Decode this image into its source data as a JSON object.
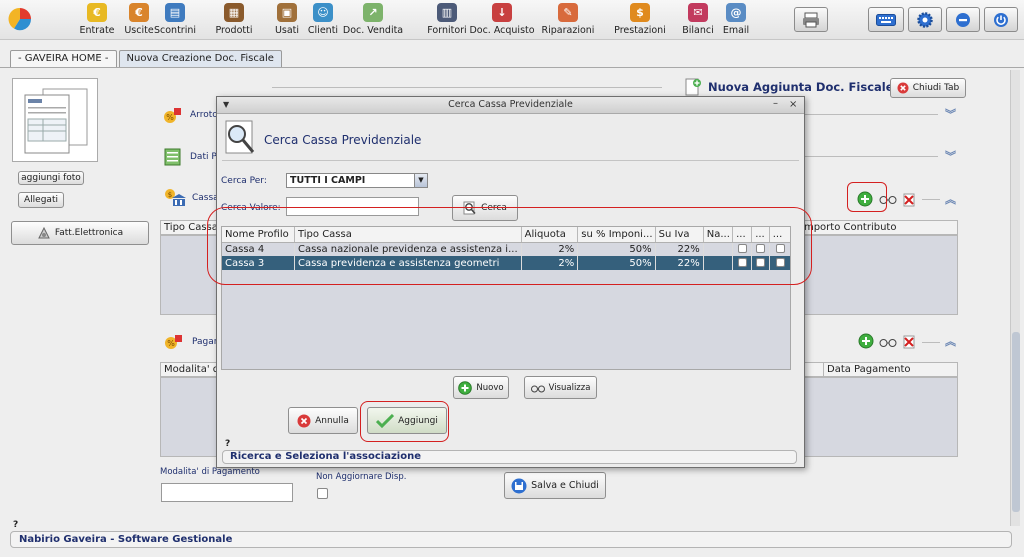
{
  "toolbar": {
    "items": [
      {
        "label": "Entrate",
        "icon": "coin-icon",
        "color": "#e8b923",
        "glyph": "€"
      },
      {
        "label": "Uscite",
        "icon": "coin-out-icon",
        "color": "#d9842b",
        "glyph": "€"
      },
      {
        "label": "Scontrini",
        "icon": "receipt-icon",
        "color": "#3f7bbf",
        "glyph": "▤"
      },
      {
        "label": "Prodotti",
        "icon": "boxes-icon",
        "color": "#8a5a2c",
        "glyph": "▦"
      },
      {
        "label": "Usati",
        "icon": "box-icon",
        "color": "#a0703a",
        "glyph": "▣"
      },
      {
        "label": "Clienti",
        "icon": "client-icon",
        "color": "#3c90c8",
        "glyph": "☺"
      },
      {
        "label": "Doc. Vendita",
        "icon": "sale-doc-icon",
        "color": "#7db36b",
        "glyph": "↗"
      },
      {
        "label": "Fornitori",
        "icon": "supplier-icon",
        "color": "#4c5a78",
        "glyph": "▥"
      },
      {
        "label": "Doc. Acquisto",
        "icon": "purchase-doc-icon",
        "color": "#c84040",
        "glyph": "↓"
      },
      {
        "label": "Riparazioni",
        "icon": "repair-icon",
        "color": "#d86a3c",
        "glyph": "✎"
      },
      {
        "label": "Prestazioni",
        "icon": "service-icon",
        "color": "#e08a1e",
        "glyph": "$"
      },
      {
        "label": "Bilanci",
        "icon": "balance-icon",
        "color": "#c23a5e",
        "glyph": "✉"
      },
      {
        "label": "Email",
        "icon": "email-icon",
        "color": "#5a8cc4",
        "glyph": "@"
      }
    ]
  },
  "tabs": [
    {
      "label": "- GAVEIRA HOME -"
    },
    {
      "label": "Nuova Creazione Doc. Fiscale"
    }
  ],
  "left": {
    "add_photo": "aggiungi foto",
    "attachments": "Allegati",
    "e_invoice": "Fatt.Elettronica"
  },
  "form": {
    "page_title": "Nuova Aggiunta Doc. Fiscale",
    "close_tab": "Chiudi Tab",
    "sections": {
      "rounding": "Arrotondamenti",
      "data": "Dati P",
      "cassa": "Cassa",
      "payments": "Pagamenti"
    },
    "cassa_grid": {
      "col_first": "Tipo Cassa",
      "col_last": "Importo Contributo"
    },
    "pay_grid": {
      "col_first": "Modalita' di",
      "col_last": "Data Pagamento"
    },
    "payment_mode_label": "Modalita' di Pagamento",
    "payment_mode_value": "",
    "no_update_label": "Non Aggiornare Disp.",
    "save_close": "Salva e Chiudi"
  },
  "dialog": {
    "window_title": "Cerca Cassa Previdenziale",
    "heading": "Cerca Cassa Previdenziale",
    "search_by_label": "Cerca Per:",
    "search_by_value": "TUTTI I CAMPI",
    "search_value_label": "Cerca Valore:",
    "search_value": "",
    "search_button": "Cerca",
    "columns": [
      "Nome Profilo",
      "Tipo Cassa",
      "Aliquota",
      "su % Imponi...",
      "Su Iva",
      "Na...",
      "...",
      "...",
      "..."
    ],
    "rows": [
      {
        "nome": "Cassa 4",
        "tipo": "Cassa nazionale previdenza e assistenza i...",
        "aliquota": "2%",
        "imponibile": "50%",
        "iva": "22%",
        "selected": false
      },
      {
        "nome": "Cassa 3",
        "tipo": "Cassa previdenza e assistenza geometri",
        "aliquota": "2%",
        "imponibile": "50%",
        "iva": "22%",
        "selected": true
      }
    ],
    "new_button": "Nuovo",
    "view_button": "Visualizza",
    "cancel_button": "Annulla",
    "add_button": "Aggiungi",
    "help_mark": "?",
    "status_text": "Ricerca e Seleziona l'associazione"
  },
  "statusbar": {
    "help_mark": "?",
    "text": "Nabirio Gaveira - Software Gestionale"
  },
  "colors": {
    "highlight_red": "#d42020",
    "selected_row": "#35607c",
    "status_text": "#1f2f6e"
  }
}
